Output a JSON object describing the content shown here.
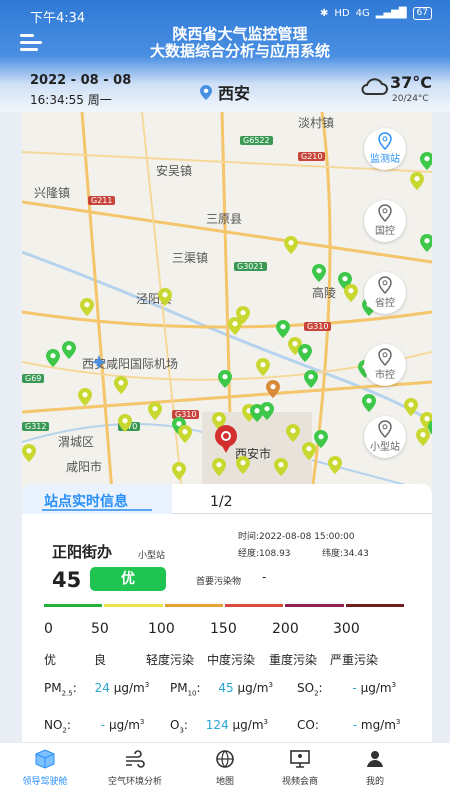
{
  "status_bar": {
    "time": "下午4:34",
    "hd": "HD",
    "network": "4G",
    "battery": "67"
  },
  "header": {
    "title_line1": "陕西省大气监控管理",
    "title_line2": "大数据综合分析与应用系统",
    "date": "2022 - 08 - 08",
    "time_weekday": "16:34:55 周一",
    "city": "西安",
    "temperature": "37°C",
    "temp_range": "20/24°C"
  },
  "map": {
    "places": [
      "淡村镇",
      "安吴镇",
      "兴隆镇",
      "三原县",
      "三渠镇",
      "泾阳县",
      "高陵",
      "西安咸阳国际机场",
      "渭城区",
      "咸阳市",
      "西安市"
    ],
    "road_labels": [
      "G6522",
      "G210",
      "G211",
      "G3021",
      "G310",
      "G69",
      "G70",
      "G312",
      "G310"
    ],
    "filters": [
      "监测站",
      "国控",
      "省控",
      "市控",
      "小型站"
    ],
    "colors": {
      "good": "#3ec84a",
      "moderate": "#c8d830",
      "selected": "#d32f2f",
      "orange": "#d98b3a",
      "water": "#b6d3ee"
    }
  },
  "panel": {
    "title": "站点实时信息",
    "page": "1/2",
    "station_name": "正阳街办",
    "station_type": "小型站",
    "time": "时间:2022-08-08 15:00:00",
    "longitude": "经度:108.93",
    "latitude": "纬度:34.43",
    "aqi": "45",
    "grade": "优",
    "primary_pollutant_label": "首要污染物",
    "primary_pollutant_value": "-",
    "scale_colors": [
      "#25b23a",
      "#e9e64a",
      "#e6a035",
      "#d84b3e",
      "#8e2253",
      "#6f1e1e"
    ],
    "ticks": [
      "0",
      "50",
      "100",
      "150",
      "200",
      "300"
    ],
    "levels": [
      "优",
      "良",
      "轻度污染",
      "中度污染",
      "重度污染",
      "严重污染"
    ],
    "pollutants": [
      {
        "name": "PM",
        "sub": "2.5",
        "sep": ":",
        "value": "24",
        "unit": "μg/m",
        "sup": "3"
      },
      {
        "name": "PM",
        "sub": "10",
        "sep": ":",
        "value": "45",
        "unit": "μg/m",
        "sup": "3"
      },
      {
        "name": "SO",
        "sub": "2",
        "sep": ":",
        "value": "-",
        "unit": "μg/m",
        "sup": "3"
      },
      {
        "name": "NO",
        "sub": "2",
        "sep": ":",
        "value": "-",
        "unit": "μg/m",
        "sup": "3"
      },
      {
        "name": "O",
        "sub": "3",
        "sep": ":",
        "value": "124",
        "unit": "μg/m",
        "sup": "3"
      },
      {
        "name": "CO",
        "sub": "",
        "sep": ":",
        "value": "-",
        "unit": "mg/m",
        "sup": "3"
      }
    ]
  },
  "nav": [
    "领导驾驶舱",
    "空气环境分析",
    "地图",
    "视频会商",
    "我的"
  ]
}
